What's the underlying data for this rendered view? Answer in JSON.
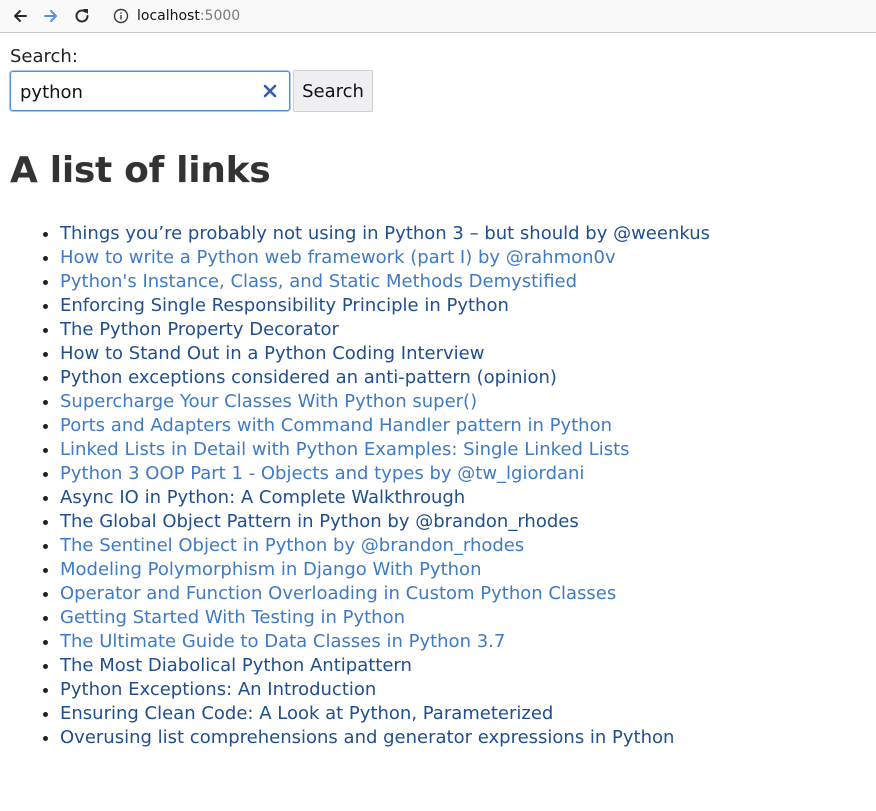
{
  "browser": {
    "url_host": "localhost",
    "url_port": ":5000"
  },
  "search": {
    "label": "Search:",
    "value": "python",
    "button_label": "Search"
  },
  "page": {
    "title": "A list of links"
  },
  "links": [
    {
      "text": "Things you’re probably not using in Python 3 – but should by @weenkus",
      "style": "dark"
    },
    {
      "text": "How to write a Python web framework (part I) by @rahmon0v",
      "style": "light"
    },
    {
      "text": "Python's Instance, Class, and Static Methods Demystified",
      "style": "light"
    },
    {
      "text": "Enforcing Single Responsibility Principle in Python",
      "style": "dark"
    },
    {
      "text": "The Python Property Decorator",
      "style": "dark"
    },
    {
      "text": "How to Stand Out in a Python Coding Interview",
      "style": "dark"
    },
    {
      "text": "Python exceptions considered an anti-pattern (opinion)",
      "style": "dark"
    },
    {
      "text": "Supercharge Your Classes With Python super()",
      "style": "light"
    },
    {
      "text": "Ports and Adapters with Command Handler pattern in Python",
      "style": "light"
    },
    {
      "text": "Linked Lists in Detail with Python Examples: Single Linked Lists",
      "style": "light"
    },
    {
      "text": "Python 3 OOP Part 1 - Objects and types by @tw_lgiordani",
      "style": "light"
    },
    {
      "text": "Async IO in Python: A Complete Walkthrough",
      "style": "dark"
    },
    {
      "text": "The Global Object Pattern in Python by @brandon_rhodes",
      "style": "dark"
    },
    {
      "text": "The Sentinel Object in Python by @brandon_rhodes",
      "style": "light"
    },
    {
      "text": "Modeling Polymorphism in Django With Python",
      "style": "light"
    },
    {
      "text": "Operator and Function Overloading in Custom Python Classes",
      "style": "light"
    },
    {
      "text": "Getting Started With Testing in Python",
      "style": "light"
    },
    {
      "text": "The Ultimate Guide to Data Classes in Python 3.7",
      "style": "light"
    },
    {
      "text": "The Most Diabolical Python Antipattern",
      "style": "dark"
    },
    {
      "text": "Python Exceptions: An Introduction",
      "style": "dark"
    },
    {
      "text": "Ensuring Clean Code: A Look at Python, Parameterized",
      "style": "dark"
    },
    {
      "text": "Overusing list comprehensions and generator expressions in Python",
      "style": "dark"
    }
  ],
  "colors": {
    "link_dark": "#1f4f8f",
    "link_light": "#3f7bc4",
    "focus_ring": "#4f8ee2"
  }
}
